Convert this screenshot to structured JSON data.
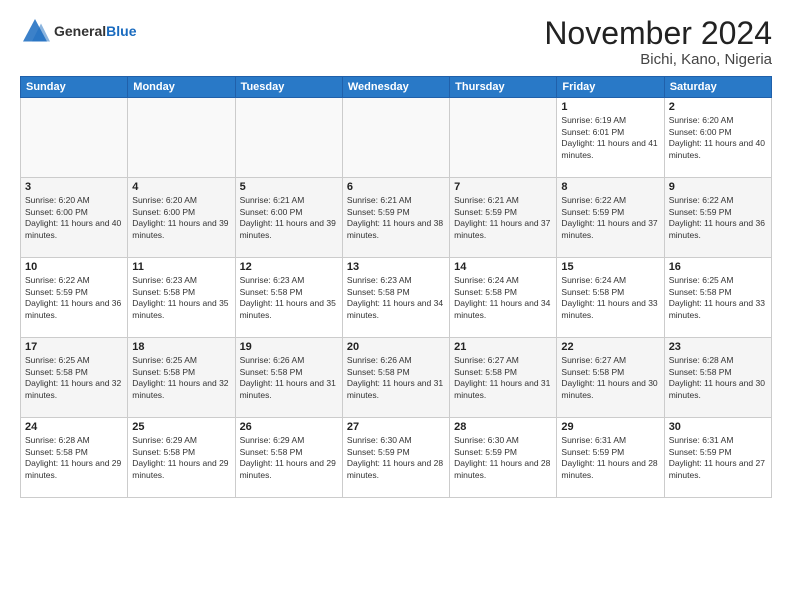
{
  "logo": {
    "general": "General",
    "blue": "Blue"
  },
  "header": {
    "month": "November 2024",
    "location": "Bichi, Kano, Nigeria"
  },
  "weekdays": [
    "Sunday",
    "Monday",
    "Tuesday",
    "Wednesday",
    "Thursday",
    "Friday",
    "Saturday"
  ],
  "weeks": [
    [
      {
        "day": "",
        "info": ""
      },
      {
        "day": "",
        "info": ""
      },
      {
        "day": "",
        "info": ""
      },
      {
        "day": "",
        "info": ""
      },
      {
        "day": "",
        "info": ""
      },
      {
        "day": "1",
        "info": "Sunrise: 6:19 AM\nSunset: 6:01 PM\nDaylight: 11 hours and 41 minutes."
      },
      {
        "day": "2",
        "info": "Sunrise: 6:20 AM\nSunset: 6:00 PM\nDaylight: 11 hours and 40 minutes."
      }
    ],
    [
      {
        "day": "3",
        "info": "Sunrise: 6:20 AM\nSunset: 6:00 PM\nDaylight: 11 hours and 40 minutes."
      },
      {
        "day": "4",
        "info": "Sunrise: 6:20 AM\nSunset: 6:00 PM\nDaylight: 11 hours and 39 minutes."
      },
      {
        "day": "5",
        "info": "Sunrise: 6:21 AM\nSunset: 6:00 PM\nDaylight: 11 hours and 39 minutes."
      },
      {
        "day": "6",
        "info": "Sunrise: 6:21 AM\nSunset: 5:59 PM\nDaylight: 11 hours and 38 minutes."
      },
      {
        "day": "7",
        "info": "Sunrise: 6:21 AM\nSunset: 5:59 PM\nDaylight: 11 hours and 37 minutes."
      },
      {
        "day": "8",
        "info": "Sunrise: 6:22 AM\nSunset: 5:59 PM\nDaylight: 11 hours and 37 minutes."
      },
      {
        "day": "9",
        "info": "Sunrise: 6:22 AM\nSunset: 5:59 PM\nDaylight: 11 hours and 36 minutes."
      }
    ],
    [
      {
        "day": "10",
        "info": "Sunrise: 6:22 AM\nSunset: 5:59 PM\nDaylight: 11 hours and 36 minutes."
      },
      {
        "day": "11",
        "info": "Sunrise: 6:23 AM\nSunset: 5:58 PM\nDaylight: 11 hours and 35 minutes."
      },
      {
        "day": "12",
        "info": "Sunrise: 6:23 AM\nSunset: 5:58 PM\nDaylight: 11 hours and 35 minutes."
      },
      {
        "day": "13",
        "info": "Sunrise: 6:23 AM\nSunset: 5:58 PM\nDaylight: 11 hours and 34 minutes."
      },
      {
        "day": "14",
        "info": "Sunrise: 6:24 AM\nSunset: 5:58 PM\nDaylight: 11 hours and 34 minutes."
      },
      {
        "day": "15",
        "info": "Sunrise: 6:24 AM\nSunset: 5:58 PM\nDaylight: 11 hours and 33 minutes."
      },
      {
        "day": "16",
        "info": "Sunrise: 6:25 AM\nSunset: 5:58 PM\nDaylight: 11 hours and 33 minutes."
      }
    ],
    [
      {
        "day": "17",
        "info": "Sunrise: 6:25 AM\nSunset: 5:58 PM\nDaylight: 11 hours and 32 minutes."
      },
      {
        "day": "18",
        "info": "Sunrise: 6:25 AM\nSunset: 5:58 PM\nDaylight: 11 hours and 32 minutes."
      },
      {
        "day": "19",
        "info": "Sunrise: 6:26 AM\nSunset: 5:58 PM\nDaylight: 11 hours and 31 minutes."
      },
      {
        "day": "20",
        "info": "Sunrise: 6:26 AM\nSunset: 5:58 PM\nDaylight: 11 hours and 31 minutes."
      },
      {
        "day": "21",
        "info": "Sunrise: 6:27 AM\nSunset: 5:58 PM\nDaylight: 11 hours and 31 minutes."
      },
      {
        "day": "22",
        "info": "Sunrise: 6:27 AM\nSunset: 5:58 PM\nDaylight: 11 hours and 30 minutes."
      },
      {
        "day": "23",
        "info": "Sunrise: 6:28 AM\nSunset: 5:58 PM\nDaylight: 11 hours and 30 minutes."
      }
    ],
    [
      {
        "day": "24",
        "info": "Sunrise: 6:28 AM\nSunset: 5:58 PM\nDaylight: 11 hours and 29 minutes."
      },
      {
        "day": "25",
        "info": "Sunrise: 6:29 AM\nSunset: 5:58 PM\nDaylight: 11 hours and 29 minutes."
      },
      {
        "day": "26",
        "info": "Sunrise: 6:29 AM\nSunset: 5:58 PM\nDaylight: 11 hours and 29 minutes."
      },
      {
        "day": "27",
        "info": "Sunrise: 6:30 AM\nSunset: 5:59 PM\nDaylight: 11 hours and 28 minutes."
      },
      {
        "day": "28",
        "info": "Sunrise: 6:30 AM\nSunset: 5:59 PM\nDaylight: 11 hours and 28 minutes."
      },
      {
        "day": "29",
        "info": "Sunrise: 6:31 AM\nSunset: 5:59 PM\nDaylight: 11 hours and 28 minutes."
      },
      {
        "day": "30",
        "info": "Sunrise: 6:31 AM\nSunset: 5:59 PM\nDaylight: 11 hours and 27 minutes."
      }
    ]
  ]
}
